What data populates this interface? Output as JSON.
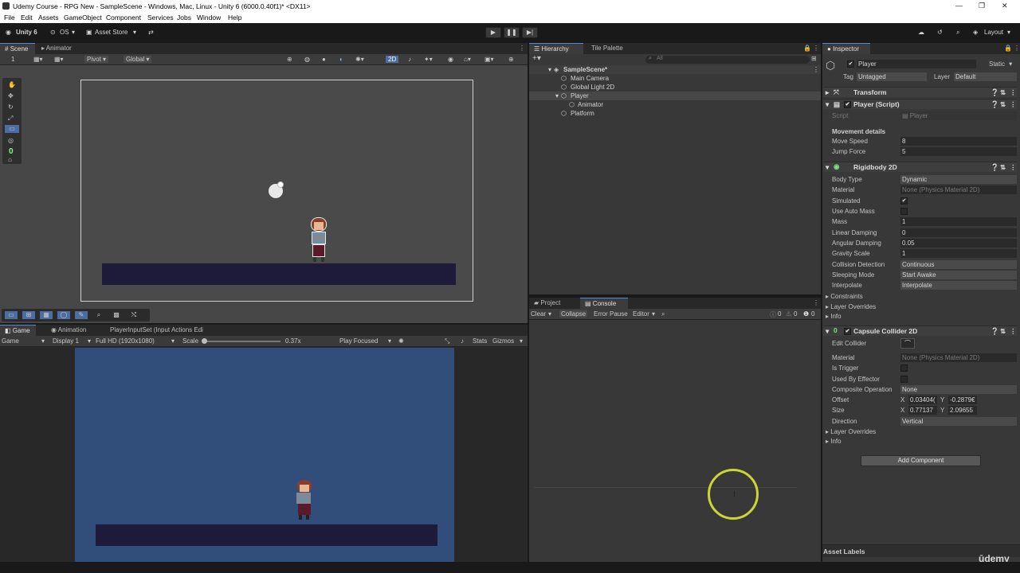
{
  "window": {
    "title": "Udemy Course - RPG New - SampleScene - Windows, Mac, Linux - Unity 6 (6000.0.40f1)* <DX11>"
  },
  "menu": [
    "File",
    "Edit",
    "Assets",
    "GameObject",
    "Component",
    "Services",
    "Jobs",
    "Window",
    "Help"
  ],
  "toolbar": {
    "account": "Unity 6",
    "os": "OS",
    "asset_store": "Asset Store",
    "layout": "Layout"
  },
  "scene_panel": {
    "tabs": [
      "Scene",
      "Animator"
    ],
    "layer_value": "1",
    "pivot": "Pivot",
    "global": "Global",
    "mode_2d": "2D",
    "tool_number": "0"
  },
  "game_panel": {
    "tabs": [
      "Game",
      "Animation",
      "PlayerInputSet (Input Actions Edi"
    ],
    "mode": "Game",
    "display": "Display 1",
    "resolution": "Full HD (1920x1080)",
    "scale_label": "Scale",
    "scale_value": "0.37x",
    "play_focused": "Play Focused",
    "stats": "Stats",
    "gizmos": "Gizmos",
    "bg_color": "#314d79",
    "platform_color": "#1d1a3a"
  },
  "hierarchy": {
    "tabs": [
      "Hierarchy",
      "Tile Palette"
    ],
    "search_placeholder": "All",
    "items": [
      {
        "label": "SampleScene*"
      },
      {
        "label": "Main Camera"
      },
      {
        "label": "Global Light 2D"
      },
      {
        "label": "Player"
      },
      {
        "label": "Animator"
      },
      {
        "label": "Platform"
      }
    ]
  },
  "console": {
    "tabs": [
      "Project",
      "Console"
    ],
    "clear": "Clear",
    "collapse": "Collapse",
    "error_pause": "Error Pause",
    "editor": "Editor",
    "log_count": "0",
    "warn_count": "0",
    "error_count": "0"
  },
  "inspector": {
    "tab": "Inspector",
    "object_name": "Player",
    "static_label": "Static",
    "tag_label": "Tag",
    "tag_value": "Untagged",
    "layer_label": "Layer",
    "layer_value": "Default",
    "transform": "Transform",
    "player_script": {
      "title": "Player (Script)",
      "script_label": "Script",
      "script_value": "Player",
      "section": "Movement details",
      "move_speed_label": "Move Speed",
      "move_speed": "8",
      "jump_force_label": "Jump Force",
      "jump_force": "5"
    },
    "rigidbody": {
      "title": "Rigidbody 2D",
      "rows": [
        {
          "label": "Body Type",
          "value": "Dynamic"
        },
        {
          "label": "Material",
          "value": "None (Physics Material 2D)"
        },
        {
          "label": "Simulated",
          "value": "✔"
        },
        {
          "label": "Use Auto Mass",
          "value": ""
        },
        {
          "label": "Mass",
          "value": "1"
        },
        {
          "label": "Linear Damping",
          "value": "0"
        },
        {
          "label": "Angular Damping",
          "value": "0.05"
        },
        {
          "label": "Gravity Scale",
          "value": "1"
        },
        {
          "label": "Collision Detection",
          "value": "Continuous"
        },
        {
          "label": "Sleeping Mode",
          "value": "Start Awake"
        },
        {
          "label": "Interpolate",
          "value": "Interpolate"
        }
      ],
      "foldouts": [
        "Constraints",
        "Layer Overrides",
        "Info"
      ]
    },
    "capsule": {
      "title": "Capsule Collider 2D",
      "edit_collider": "Edit Collider",
      "material_label": "Material",
      "material_value": "None (Physics Material 2D)",
      "is_trigger": "Is Trigger",
      "used_by_effector": "Used By Effector",
      "composite_label": "Composite Operation",
      "composite_value": "None",
      "offset_label": "Offset",
      "offset_x": "0.03404(",
      "offset_y": "-0.2879€",
      "size_label": "Size",
      "size_x": "0.77137",
      "size_y": "2.09655",
      "direction_label": "Direction",
      "direction_value": "Vertical",
      "x_label": "X",
      "y_label": "Y",
      "foldouts": [
        "Layer Overrides",
        "Info"
      ]
    },
    "add_component": "Add Component",
    "asset_labels": "Asset Labels"
  },
  "watermark": "ūdemy",
  "colors": {
    "scene_bg": "#474747",
    "accent": "#4c8fd6",
    "cursor_ring": "#c9d634"
  }
}
